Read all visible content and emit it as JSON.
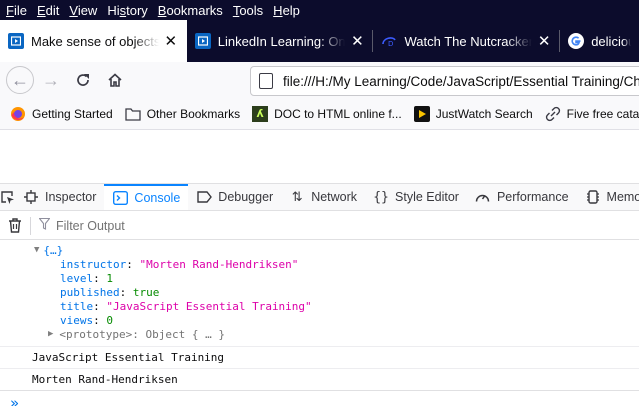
{
  "menu": [
    "File",
    "Edit",
    "View",
    "History",
    "Bookmarks",
    "Tools",
    "Help"
  ],
  "menu_underline": [
    "F",
    "E",
    "V",
    "s",
    "B",
    "T",
    "H"
  ],
  "tabs": [
    {
      "title": "Make sense of objects",
      "icon": "linkedin-learning-icon",
      "color": "#0a66c2"
    },
    {
      "title": "LinkedIn Learning: Online",
      "icon": "linkedin-learning-icon",
      "color": "#0a66c2"
    },
    {
      "title": "Watch The Nutcracker and",
      "icon": "disney-plus-icon",
      "color": "#1a3fd6"
    },
    {
      "title": "deliciou",
      "icon": "google-icon",
      "color": "#ffffff"
    }
  ],
  "address": {
    "url": "file:///H:/My Learning/Code/JavaScript/Essential Training/Ch"
  },
  "bookmarks": [
    {
      "label": "Getting Started",
      "icon": "firefox-icon"
    },
    {
      "label": "Other Bookmarks",
      "icon": "folder-icon"
    },
    {
      "label": "DOC to HTML online f...",
      "icon": "doc-converter-icon"
    },
    {
      "label": "JustWatch Search",
      "icon": "justwatch-icon"
    },
    {
      "label": "Five free catalogi",
      "icon": "link-icon"
    }
  ],
  "devtools": {
    "tabs": [
      "Inspector",
      "Console",
      "Debugger",
      "Network",
      "Style Editor",
      "Performance",
      "Memo"
    ],
    "active_tab": "Console",
    "filter_placeholder": "Filter Output"
  },
  "console": {
    "object_summary": "{…}",
    "properties": [
      {
        "key": "instructor",
        "value": "\"Morten Rand-Hendriksen\"",
        "type": "string"
      },
      {
        "key": "level",
        "value": "1",
        "type": "number"
      },
      {
        "key": "published",
        "value": "true",
        "type": "boolean"
      },
      {
        "key": "title",
        "value": "\"JavaScript Essential Training\"",
        "type": "string"
      },
      {
        "key": "views",
        "value": "0",
        "type": "number"
      }
    ],
    "prototype_label": "<prototype>: Object { … }",
    "messages": [
      "JavaScript Essential Training",
      "Morten Rand-Hendriksen"
    ],
    "prompt": "»"
  }
}
